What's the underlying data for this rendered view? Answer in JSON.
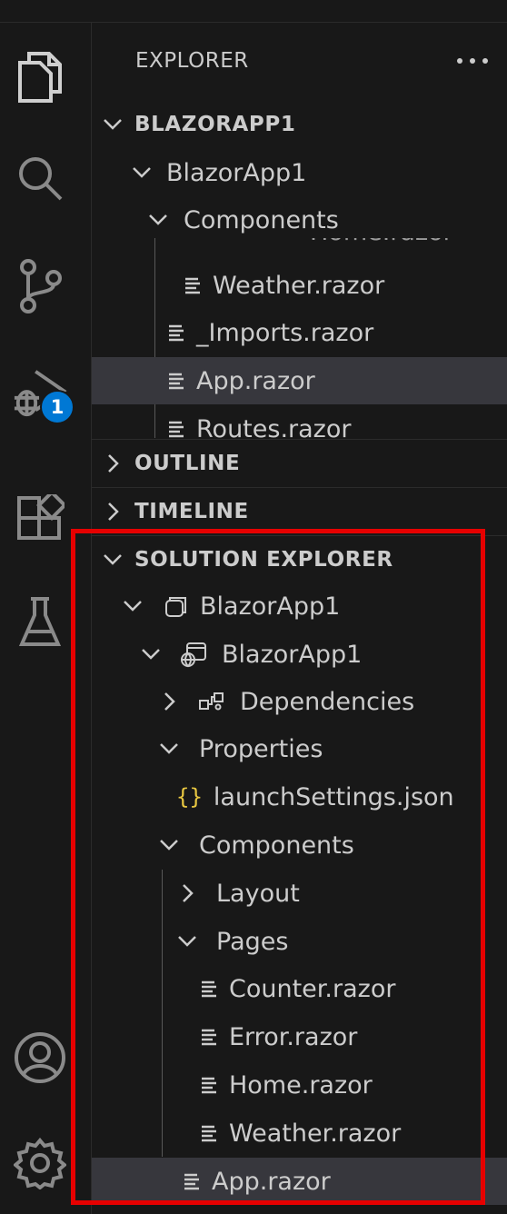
{
  "explorer": {
    "title": "EXPLORER",
    "sections": {
      "workspace": "BLAZORAPP1",
      "outline": "OUTLINE",
      "timeline": "TIMELINE",
      "solution_explorer": "SOLUTION EXPLORER"
    },
    "tree": {
      "folder_blazorapp1": "BlazorApp1",
      "folder_components": "Components",
      "partial_home": "Home.razor",
      "weather": "Weather.razor",
      "imports": "_Imports.razor",
      "app": "App.razor",
      "routes": "Routes.razor"
    }
  },
  "solution": {
    "solution_name": "BlazorApp1",
    "project_name": "BlazorApp1",
    "dependencies": "Dependencies",
    "properties": "Properties",
    "launch_settings": "launchSettings.json",
    "json_icon_text": "{}",
    "components": "Components",
    "layout": "Layout",
    "pages": "Pages",
    "counter": "Counter.razor",
    "error": "Error.razor",
    "home": "Home.razor",
    "weather": "Weather.razor",
    "app": "App.razor"
  },
  "activity_bar": {
    "icons": [
      "files-icon",
      "search-icon",
      "source-control-icon",
      "run-debug-icon",
      "extensions-icon",
      "testing-icon",
      "account-icon",
      "settings-gear-icon"
    ],
    "run_debug_badge": "1"
  },
  "colors": {
    "background": "#181818",
    "selected_row": "#37373d",
    "badge": "#0078d4",
    "highlight_border": "#e60000",
    "json_icon": "#e8c741"
  }
}
